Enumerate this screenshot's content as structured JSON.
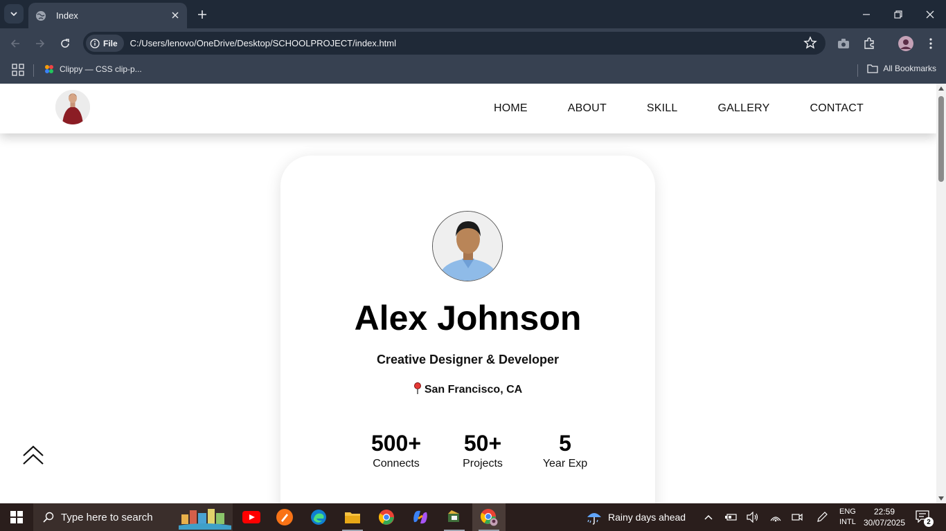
{
  "browser": {
    "tab_title": "Index",
    "url_chip": "File",
    "url": "C:/Users/lenovo/OneDrive/Desktop/SCHOOLPROJECT/index.html",
    "bookmark_item": "Clippy — CSS clip-p...",
    "all_bookmarks": "All Bookmarks"
  },
  "site": {
    "nav_links": [
      "HOME",
      "ABOUT",
      "SKILL",
      "GALLERY",
      "CONTACT"
    ],
    "profile": {
      "name": "Alex Johnson",
      "role": "Creative Designer & Developer",
      "location": "San Francisco, CA"
    },
    "stats": [
      {
        "value": "500+",
        "label": "Connects"
      },
      {
        "value": "50+",
        "label": "Projects"
      },
      {
        "value": "5",
        "label": "Year Exp"
      }
    ]
  },
  "taskbar": {
    "search_placeholder": "Type here to search",
    "weather": "Rainy days ahead",
    "lang_line1": "ENG",
    "lang_line2": "INTL",
    "time": "22:59",
    "date": "30/07/2025",
    "notification_count": "2"
  },
  "colors": {
    "chrome_dark": "#1f2937",
    "chrome_mid": "#374151",
    "taskbar": "#2a1e1c"
  }
}
